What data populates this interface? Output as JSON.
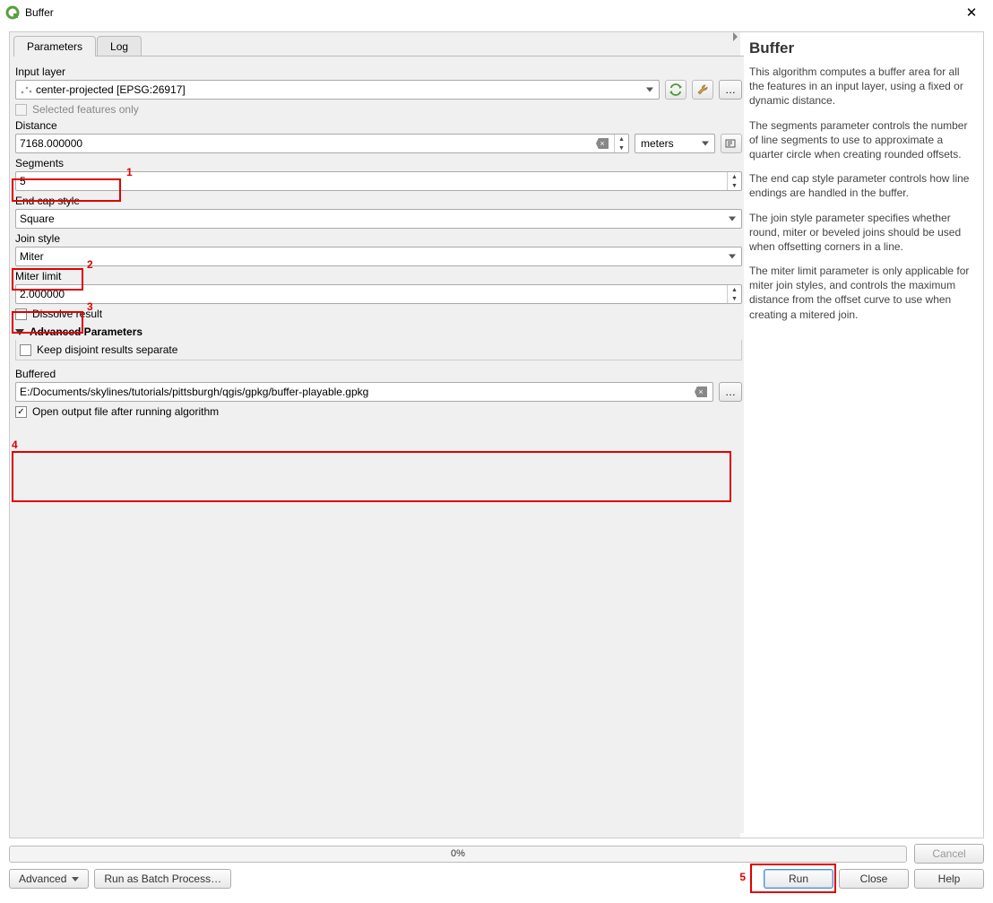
{
  "window": {
    "title": "Buffer"
  },
  "tabs": {
    "parameters": "Parameters",
    "log": "Log"
  },
  "inputLayer": {
    "label": "Input layer",
    "value": "center-projected [EPSG:26917]",
    "selectedOnly": "Selected features only"
  },
  "distance": {
    "label": "Distance",
    "value": "7168.000000",
    "unit": "meters"
  },
  "segments": {
    "label": "Segments",
    "value": "5"
  },
  "endCap": {
    "label": "End cap style",
    "value": "Square"
  },
  "joinStyle": {
    "label": "Join style",
    "value": "Miter"
  },
  "miterLimit": {
    "label": "Miter limit",
    "value": "2.000000"
  },
  "dissolve": {
    "label": "Dissolve result"
  },
  "advanced": {
    "header": "Advanced Parameters",
    "keepDisjoint": "Keep disjoint results separate"
  },
  "buffered": {
    "label": "Buffered",
    "value": "E:/Documents/skylines/tutorials/pittsburgh/qgis/gpkg/buffer-playable.gpkg"
  },
  "openAfter": {
    "label": "Open output file after running algorithm"
  },
  "progress": {
    "text": "0%"
  },
  "buttons": {
    "advanced": "Advanced",
    "batch": "Run as Batch Process…",
    "run": "Run",
    "close": "Close",
    "help": "Help",
    "cancel": "Cancel"
  },
  "help": {
    "title": "Buffer",
    "p1": "This algorithm computes a buffer area for all the features in an input layer, using a fixed or dynamic distance.",
    "p2": "The segments parameter controls the number of line segments to use to approximate a quarter circle when creating rounded offsets.",
    "p3": "The end cap style parameter controls how line endings are handled in the buffer.",
    "p4": "The join style parameter specifies whether round, miter or beveled joins should be used when offsetting corners in a line.",
    "p5": "The miter limit parameter is only applicable for miter join styles, and controls the maximum distance from the offset curve to use when creating a mitered join."
  },
  "annotations": {
    "n1": "1",
    "n2": "2",
    "n3": "3",
    "n4": "4",
    "n5": "5"
  }
}
